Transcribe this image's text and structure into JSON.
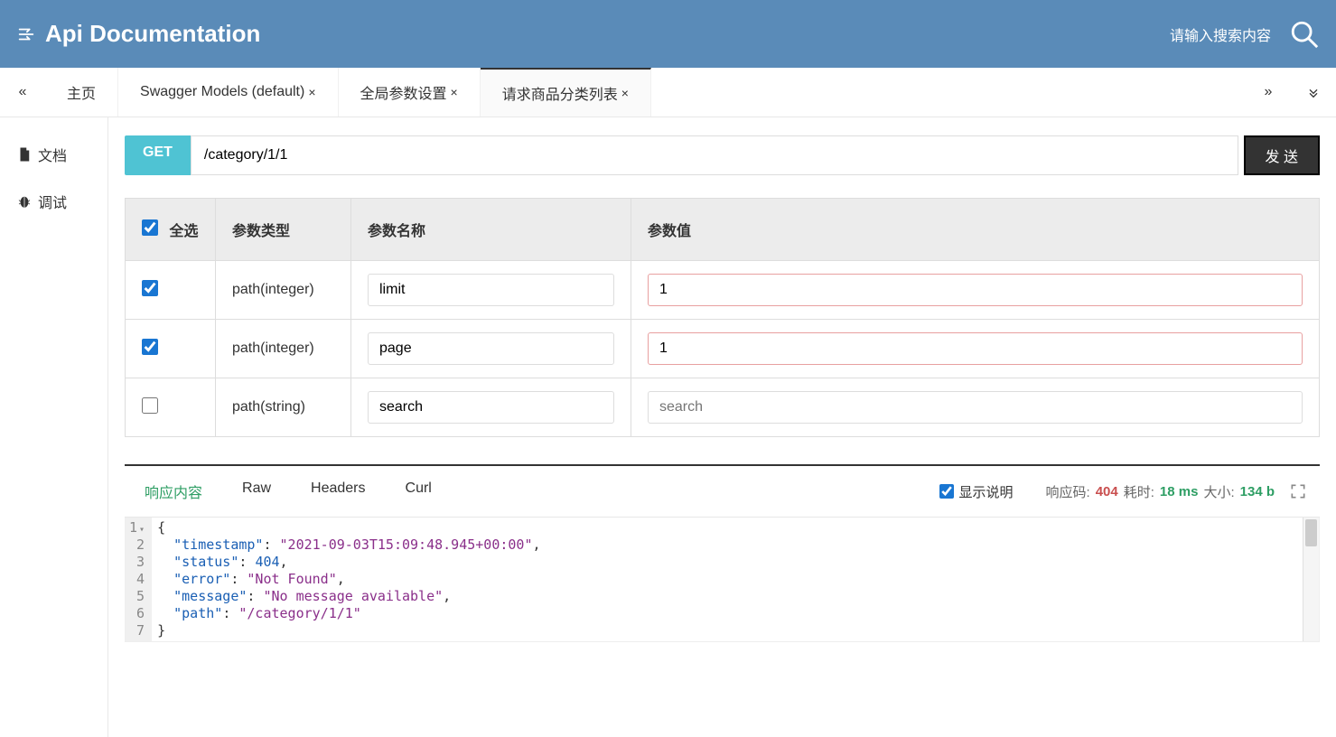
{
  "header": {
    "title": "Api Documentation",
    "search_placeholder": "请输入搜索内容"
  },
  "tabs": {
    "home": "主页",
    "items": [
      {
        "label": "Swagger Models (default)",
        "closable": true
      },
      {
        "label": "全局参数设置",
        "closable": true
      },
      {
        "label": "请求商品分类列表",
        "closable": true,
        "active": true
      }
    ]
  },
  "sidebar": {
    "doc": "文档",
    "debug": "调试"
  },
  "request": {
    "method": "GET",
    "url": "/category/1/1",
    "send": "发 送"
  },
  "params": {
    "headers": {
      "select_all": "全选",
      "type": "参数类型",
      "name": "参数名称",
      "value": "参数值"
    },
    "rows": [
      {
        "checked": true,
        "type": "path(integer)",
        "name": "limit",
        "value": "1",
        "placeholder": ""
      },
      {
        "checked": true,
        "type": "path(integer)",
        "name": "page",
        "value": "1",
        "placeholder": ""
      },
      {
        "checked": false,
        "type": "path(string)",
        "name": "search",
        "value": "",
        "placeholder": "search"
      }
    ]
  },
  "response": {
    "tabs": {
      "content": "响应内容",
      "raw": "Raw",
      "headers": "Headers",
      "curl": "Curl"
    },
    "show_desc": "显示说明",
    "meta": {
      "code_label": "响应码:",
      "code_value": "404",
      "time_label": "耗时:",
      "time_value": "18 ms",
      "size_label": "大小:",
      "size_value": "134 b"
    },
    "json": {
      "timestamp": "2021-09-03T15:09:48.945+00:00",
      "status": 404,
      "error": "Not Found",
      "message": "No message available",
      "path": "/category/1/1"
    }
  }
}
